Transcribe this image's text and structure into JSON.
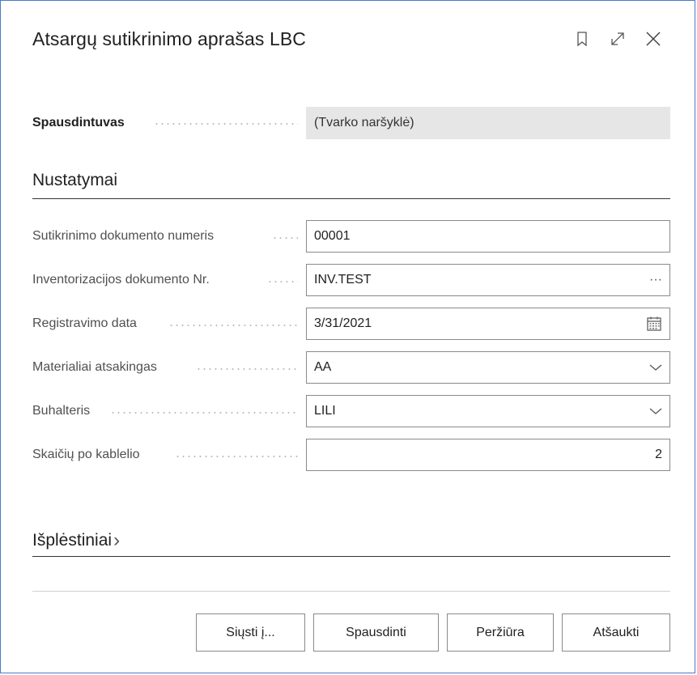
{
  "dialog": {
    "title": "Atsargų sutikrinimo aprašas LBC",
    "icons": [
      "bookmark-icon",
      "expand-icon",
      "close-icon"
    ]
  },
  "printer": {
    "label": "Spausdintuvas",
    "value": "(Tvarko naršyklė)"
  },
  "settings": {
    "title": "Nustatymai",
    "fields": [
      {
        "label": "Sutikrinimo dokumento numeris",
        "value": "00001"
      },
      {
        "label": "Inventorizacijos dokumento Nr.",
        "value": "INV.TEST",
        "trail": "···"
      },
      {
        "label": "Registravimo data",
        "value": "3/31/2021"
      },
      {
        "label": "Materialiai atsakingas",
        "value": "AA"
      },
      {
        "label": "Buhalteris",
        "value": "LILI"
      },
      {
        "label": "Skaičių po kablelio",
        "value": "2"
      }
    ]
  },
  "advanced": {
    "title": "Išplėstiniai",
    "chevron": "›"
  },
  "buttons": {
    "send": "Siųsti į...",
    "print": "Spausdinti",
    "preview": "Peržiūra",
    "cancel": "Atšaukti"
  },
  "colors": {
    "dialog_border": "#4a7ac9",
    "readonly_bg": "#e6e6e6"
  }
}
